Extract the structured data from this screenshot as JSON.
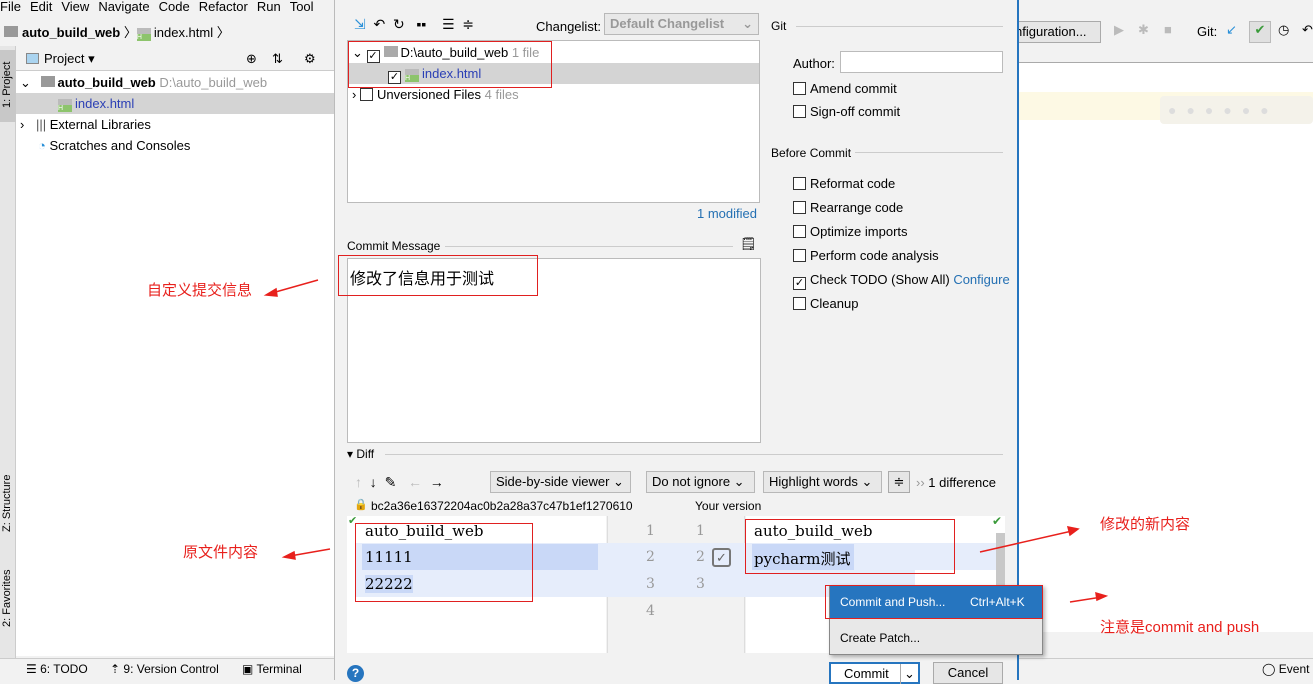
{
  "menu": [
    "File",
    "Edit",
    "View",
    "Navigate",
    "Code",
    "Refactor",
    "Run",
    "Tool"
  ],
  "breadcrumb": {
    "project": "auto_build_web",
    "file": "index.html"
  },
  "project_panel": {
    "title": "Project",
    "side_tab": "1: Project",
    "structure_tab": "Z: Structure",
    "favorites_tab": "2: Favorites",
    "tree": [
      {
        "label": "auto_build_web",
        "path": "D:\\auto_build_web"
      },
      {
        "label": "index.html"
      },
      {
        "label": "External Libraries"
      },
      {
        "label": "Scratches and Consoles"
      }
    ]
  },
  "status_bar": {
    "todo": "6: TODO",
    "vc": "9: Version Control",
    "terminal": "Terminal",
    "event_log": "Event L"
  },
  "ide_toolbar": {
    "config": "nfiguration...",
    "git_label": "Git:"
  },
  "dialog": {
    "changelist_label": "Changelist:",
    "changelist_value": "Default Changelist",
    "changes": {
      "root": "D:\\auto_build_web",
      "root_count": "1 file",
      "file": "index.html",
      "unversioned": "Unversioned Files",
      "unversioned_count": "4 files"
    },
    "modified": "1 modified",
    "commit_message_label": "Commit Message",
    "commit_message": "修改了信息用于测试",
    "git": {
      "title": "Git",
      "author_label": "Author:",
      "author_value": "",
      "amend": "Amend commit",
      "signoff": "Sign-off commit"
    },
    "before_commit": {
      "title": "Before Commit",
      "options": [
        {
          "label": "Reformat code",
          "checked": false
        },
        {
          "label": "Rearrange code",
          "checked": false
        },
        {
          "label": "Optimize imports",
          "checked": false
        },
        {
          "label": "Perform code analysis",
          "checked": false
        },
        {
          "label": "Check TODO (Show All)",
          "checked": true
        },
        {
          "label": "Cleanup",
          "checked": false
        }
      ],
      "configure": "Configure"
    },
    "diff": {
      "title": "Diff",
      "viewer": "Side-by-side viewer",
      "ignore": "Do not ignore",
      "highlight": "Highlight words",
      "differences": "1 difference",
      "revision": "bc2a36e16372204ac0b2a28a37c47b1ef1270610",
      "your_version": "Your version",
      "left_lines": [
        "auto_build_web",
        "11111",
        "22222"
      ],
      "left_numbers": [
        "1",
        "2",
        "3",
        "4"
      ],
      "right_lines": [
        "auto_build_web",
        "pycharm测试"
      ],
      "right_numbers": [
        "1",
        "2",
        "3"
      ]
    },
    "popup": {
      "commit_push": "Commit and Push...",
      "shortcut": "Ctrl+Alt+K",
      "create_patch": "Create Patch..."
    },
    "commit_button": "Commit",
    "cancel_button": "Cancel"
  },
  "annotations": {
    "commit_msg": "自定义提交信息",
    "original": "原文件内容",
    "new_content": "修改的新内容",
    "note": "注意是commit and push"
  },
  "colors": {
    "accent": "#2675bf",
    "annotation": "#e8201c",
    "diff_changed": "#c9d8f7"
  }
}
